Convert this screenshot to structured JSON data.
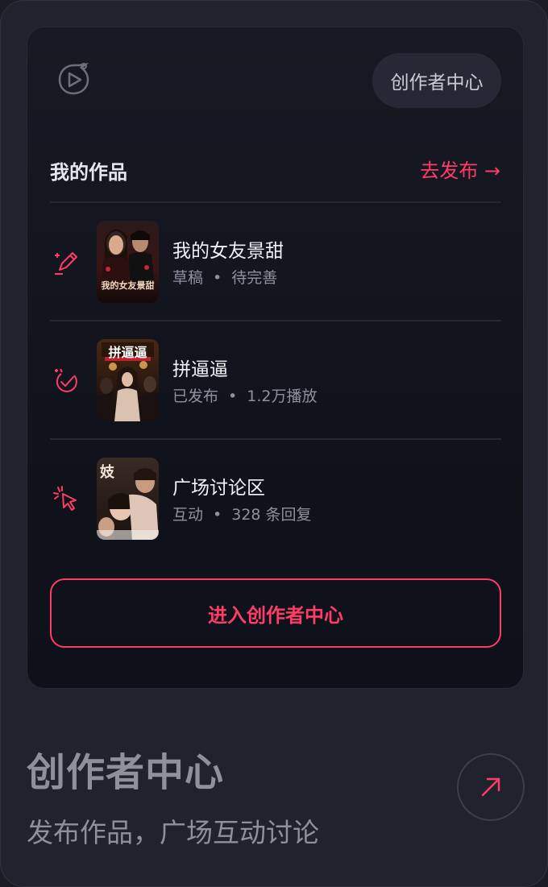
{
  "header": {
    "logo_icon": "play-bubble-logo-icon",
    "creator_center_pill": "创作者中心"
  },
  "works": {
    "title": "我的作品",
    "publish_link": "去发布 →",
    "items": [
      {
        "icon": "pencil-edit-icon",
        "title": "我的女友景甜",
        "status": "草稿",
        "detail": "待完善",
        "poster_text": "我的女友景甜"
      },
      {
        "icon": "check-badge-icon",
        "title": "拼逼逼",
        "status": "已发布",
        "detail": "1.2万播放",
        "poster_text": "拼逼逼"
      },
      {
        "icon": "cursor-click-icon",
        "title": "广场讨论区",
        "status": "互动",
        "detail": "328 条回复",
        "poster_text": "妓"
      }
    ],
    "separator": "•",
    "enter_button": "进入创作者中心"
  },
  "footer": {
    "title": "创作者中心",
    "subtitle": "发布作品，广场互动讨论",
    "arrow_icon": "arrow-up-right-icon"
  },
  "colors": {
    "accent": "#ff3b68",
    "background": "#20222e",
    "card": "#10131b"
  }
}
